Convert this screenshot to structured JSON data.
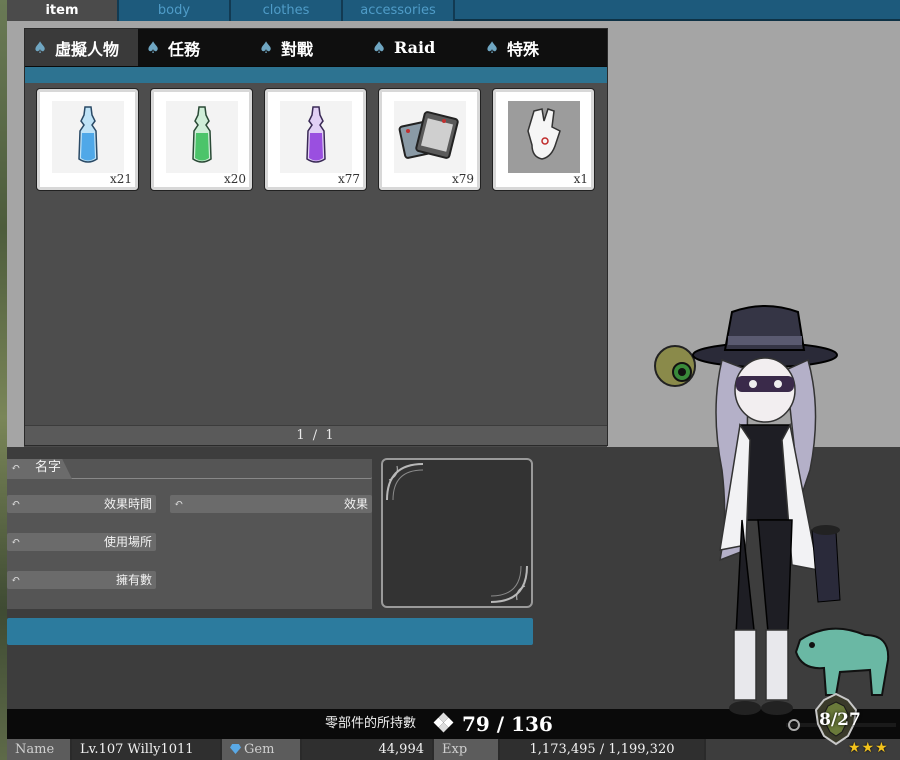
{
  "main_tabs": [
    {
      "label": "item",
      "active": true
    },
    {
      "label": "body",
      "active": false
    },
    {
      "label": "clothes",
      "active": false
    },
    {
      "label": "accessories",
      "active": false
    }
  ],
  "sub_tabs": [
    {
      "label": "虛擬人物",
      "active": true
    },
    {
      "label": "任務",
      "active": false
    },
    {
      "label": "對戰",
      "active": false
    },
    {
      "label": "Raid",
      "active": false
    },
    {
      "label": "特殊",
      "active": false
    }
  ],
  "items": [
    {
      "icon": "blue-potion-icon",
      "color": "#4fa8e8",
      "count": "x21"
    },
    {
      "icon": "green-potion-icon",
      "color": "#4cc46a",
      "count": "x20"
    },
    {
      "icon": "purple-potion-icon",
      "color": "#9a4fe0",
      "count": "x77"
    },
    {
      "icon": "cards-icon",
      "color": "#777777",
      "count": "x79"
    },
    {
      "icon": "white-glove-icon",
      "color": "#eeeeee",
      "count": "x1"
    }
  ],
  "pager": {
    "current": "1",
    "separator": "/",
    "total": "1"
  },
  "info": {
    "name_label": "名字",
    "effect_time_label": "效果時間",
    "effect_label": "效果",
    "use_location_label": "使用場所",
    "owned_label": "擁有數"
  },
  "parts": {
    "label": "零部件的所持數",
    "count": "79 / 136"
  },
  "status": {
    "name_label": "Name",
    "name_value": "Lv.107 Willy1011",
    "gem_label": "Gem",
    "gem_value": "44,994",
    "exp_label": "Exp",
    "exp_value": "1,173,495 / 1,199,320"
  },
  "rank": {
    "value": "8/27",
    "stars": "★★★"
  },
  "colors": {
    "accent_blue": "#2c7b9e",
    "tab_blue": "#1d5a7c",
    "panel_gray": "#4d4d4d",
    "star_gold": "#f2c21c"
  }
}
